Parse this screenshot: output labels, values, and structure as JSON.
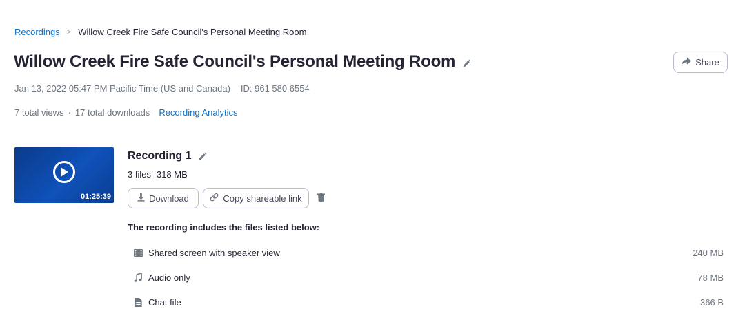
{
  "breadcrumb": {
    "parent": "Recordings",
    "separator": ">",
    "current": "Willow Creek Fire Safe Council's Personal Meeting Room"
  },
  "header": {
    "title": "Willow Creek Fire Safe Council's Personal Meeting Room",
    "share_label": "Share"
  },
  "meta": {
    "datetime": "Jan 13, 2022 05:47 PM Pacific Time (US and Canada)",
    "meeting_id": "ID: 961 580 6554"
  },
  "stats": {
    "views": "7 total views",
    "dot": "·",
    "downloads": "17 total downloads",
    "analytics_link": "Recording Analytics"
  },
  "recording": {
    "title": "Recording 1",
    "duration": "01:25:39",
    "file_count": "3 files",
    "total_size": "318 MB",
    "download_label": "Download",
    "copy_link_label": "Copy shareable link",
    "files_heading": "The recording includes the files listed below:",
    "files": [
      {
        "icon": "film-icon",
        "name": "Shared screen with speaker view",
        "size": "240 MB"
      },
      {
        "icon": "music-note-icon",
        "name": "Audio only",
        "size": "78 MB"
      },
      {
        "icon": "document-icon",
        "name": "Chat file",
        "size": "366 B"
      }
    ]
  },
  "colors": {
    "link": "#0e72c9",
    "text": "#232333",
    "muted": "#6e7680",
    "border": "#babacc",
    "thumbnail": "#0f52ba"
  }
}
